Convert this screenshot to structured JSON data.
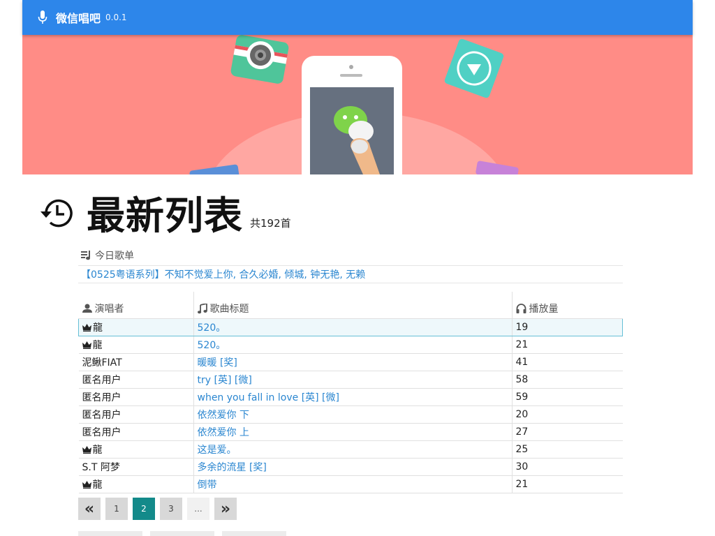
{
  "app": {
    "title": "微信唱吧",
    "version": "0.0.1"
  },
  "heading": {
    "title": "最新列表",
    "count_text": "共192首"
  },
  "today": {
    "title": "今日歌单",
    "playlist_link": "【0525粤语系列】不知不觉爱上你, 合久必婚, 倾城, 钟无艳, 无赖"
  },
  "table": {
    "headers": {
      "singer": "演唱者",
      "title": "歌曲标题",
      "plays": "播放量"
    },
    "rows": [
      {
        "crown": true,
        "singer": "龍",
        "title": "520。",
        "plays": "19"
      },
      {
        "crown": true,
        "singer": "龍",
        "title": "520。",
        "plays": "21"
      },
      {
        "crown": false,
        "singer": "泥鳅FIAT",
        "title": "暖暖 [奖]",
        "plays": "41"
      },
      {
        "crown": false,
        "singer": "匿名用户",
        "title": "try [英] [微]",
        "plays": "58"
      },
      {
        "crown": false,
        "singer": "匿名用户",
        "title": "when you fall in love [英] [微]",
        "plays": "59"
      },
      {
        "crown": false,
        "singer": "匿名用户",
        "title": "依然爱你 下",
        "plays": "20"
      },
      {
        "crown": false,
        "singer": "匿名用户",
        "title": "依然爱你 上",
        "plays": "27"
      },
      {
        "crown": true,
        "singer": "龍",
        "title": "这是爱。",
        "plays": "25"
      },
      {
        "crown": false,
        "singer": "S.T 阿梦",
        "title": "多余的流星 [奖]",
        "plays": "30"
      },
      {
        "crown": true,
        "singer": "龍",
        "title": "倒带",
        "plays": "21"
      }
    ]
  },
  "pagination": {
    "prev": "«",
    "pages": [
      "1",
      "2",
      "3"
    ],
    "current": "2",
    "ellipsis": "...",
    "next": "»"
  },
  "colors": {
    "topbar": "#2d86ea",
    "banner": "#ff8c86",
    "link": "#2a86d0",
    "current_page": "#138a8a",
    "active_row_border": "#65bfd6"
  },
  "icons": {
    "topbar": "microphone-icon",
    "heading": "history-icon",
    "today": "playlist-icon",
    "singer_header": "user-icon",
    "title_header": "music-note-icon",
    "plays_header": "headphones-icon",
    "crown": "crown-icon"
  }
}
